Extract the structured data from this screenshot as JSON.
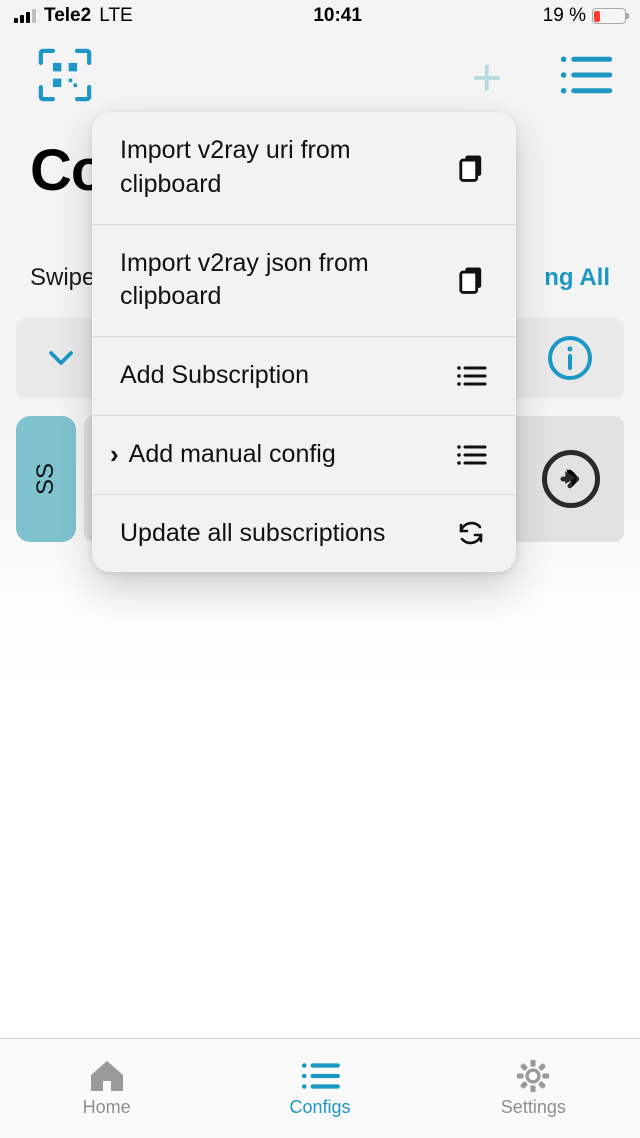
{
  "status": {
    "carrier": "Tele2",
    "network": "LTE",
    "time": "10:41",
    "battery_text": "19 %"
  },
  "page": {
    "title_fragment": "Co",
    "hint_left": "Swipe",
    "hint_right_fragment": "ng All"
  },
  "row": {
    "ss_label": "SS"
  },
  "popover": {
    "items": [
      {
        "label": "Import v2ray uri from clipboard",
        "icon": "clipboard"
      },
      {
        "label": "Import v2ray json from clipboard",
        "icon": "clipboard"
      },
      {
        "label": "Add Subscription",
        "icon": "list"
      },
      {
        "label": "Add manual config",
        "icon": "list",
        "chevron": true
      },
      {
        "label": "Update all subscriptions",
        "icon": "refresh"
      }
    ]
  },
  "tabs": {
    "home": "Home",
    "configs": "Configs",
    "settings": "Settings"
  }
}
